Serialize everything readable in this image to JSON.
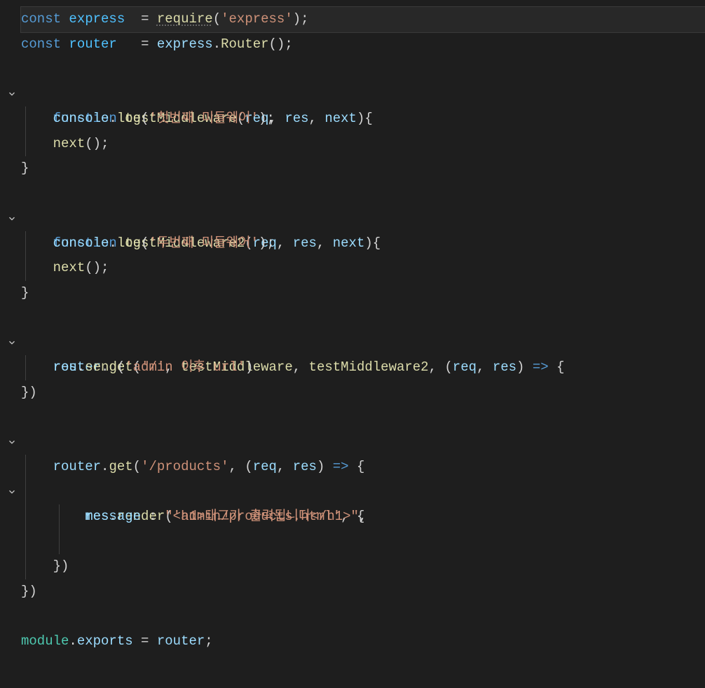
{
  "code": {
    "l0": {
      "kw1": "const",
      "v1": "express",
      "eq": "=",
      "fn": "require",
      "p1": "(",
      "s": "'express'",
      "p2": ")",
      "semi": ";"
    },
    "l1": {
      "kw1": "const",
      "v1": "router",
      "eq": "=",
      "obj": "express",
      "dot": ".",
      "fn": "Router",
      "p1": "(",
      "p2": ")",
      "semi": ";"
    },
    "l3": {
      "kw": "function",
      "name": "testMiddleware",
      "p1": "(",
      "a1": "req",
      "c1": ", ",
      "a2": "res",
      "c2": ", ",
      "a3": "next",
      "p2": ")",
      "br": "{"
    },
    "l4": {
      "obj": "console",
      "dot": ".",
      "fn": "log",
      "p1": "(",
      "s": "'첫번째 미들웨어'",
      "p2": ")",
      "semi": ";"
    },
    "l5": {
      "fn": "next",
      "p1": "(",
      "p2": ")",
      "semi": ";"
    },
    "l6": {
      "br": "}"
    },
    "l8": {
      "kw": "function",
      "name": "testMiddleware2",
      "p1": "(",
      "a1": "req",
      "c1": ", ",
      "a2": "res",
      "c2": ", ",
      "a3": "next",
      "p2": ")",
      "br": "{"
    },
    "l9": {
      "obj": "console",
      "dot": ".",
      "fn": "log",
      "p1": "(",
      "s": "'두번째 미들웨어'",
      "p2": ")",
      "semi": ";"
    },
    "l10": {
      "fn": "next",
      "p1": "(",
      "p2": ")",
      "semi": ";"
    },
    "l11": {
      "br": "}"
    },
    "l13": {
      "obj": "router",
      "dot": ".",
      "fn": "get",
      "p1": "(",
      "s": "'/'",
      "c1": ", ",
      "a1": "testMiddleware",
      "c2": ", ",
      "a2": "testMiddleware2",
      "c3": ", ",
      "p2": "(",
      "pa1": "req",
      "c4": ", ",
      "pa2": "res",
      "p3": ")",
      "arr": " => ",
      "br": "{"
    },
    "l14": {
      "obj": "res",
      "dot": ".",
      "fn": "send",
      "p1": "(",
      "s": "'admin 이후 url'",
      "p2": ")"
    },
    "l15": {
      "br": "})"
    },
    "l17": {
      "obj": "router",
      "dot": ".",
      "fn": "get",
      "p1": "(",
      "s": "'/products'",
      "c1": ", ",
      "p2": "(",
      "pa1": "req",
      "c2": ", ",
      "pa2": "res",
      "p3": ")",
      "arr": " => ",
      "br": "{"
    },
    "l19": {
      "obj": "res",
      "dot": ".",
      "fn": "render",
      "p1": "(",
      "s": "'admin/products.html'",
      "c1": ", ",
      "br": "{"
    },
    "l20": {
      "prop": "message",
      "col": " : ",
      "s": "\"<h1>태그가 출력됩니다</h1>\"",
      "c": ","
    },
    "l22": {
      "br": "})"
    },
    "l23": {
      "br": "})"
    },
    "l25": {
      "obj": "module",
      "dot": ".",
      "prop": "exports",
      "eq": " = ",
      "v": "router",
      "semi": ";"
    }
  },
  "indent": {
    "i1": "    ",
    "i2": "        "
  }
}
